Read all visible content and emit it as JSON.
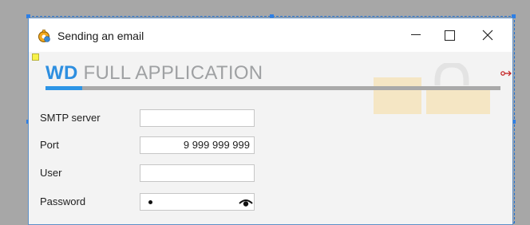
{
  "window": {
    "title": "Sending an email",
    "icon": "app-gear-globe-icon",
    "controls": {
      "minimize": "minimize-icon",
      "maximize": "maximize-icon",
      "close": "close-icon"
    }
  },
  "banner": {
    "brand": "WD",
    "subtitle": " FULL APPLICATION",
    "progress_fraction": 0.08
  },
  "form": {
    "smtp_server": {
      "label": "SMTP server",
      "value": ""
    },
    "port": {
      "label": "Port",
      "value": "9 999 999 999"
    },
    "user": {
      "label": "User",
      "value": ""
    },
    "password": {
      "label": "Password",
      "value_masked": true,
      "reveal_icon": "eye-icon"
    }
  },
  "colors": {
    "accent": "#2e8fe0",
    "titlebar": "#ffffff",
    "window_bg": "#f3f3f3",
    "editor_bg": "#a7a7a7",
    "selection": "#1e6fd0"
  }
}
